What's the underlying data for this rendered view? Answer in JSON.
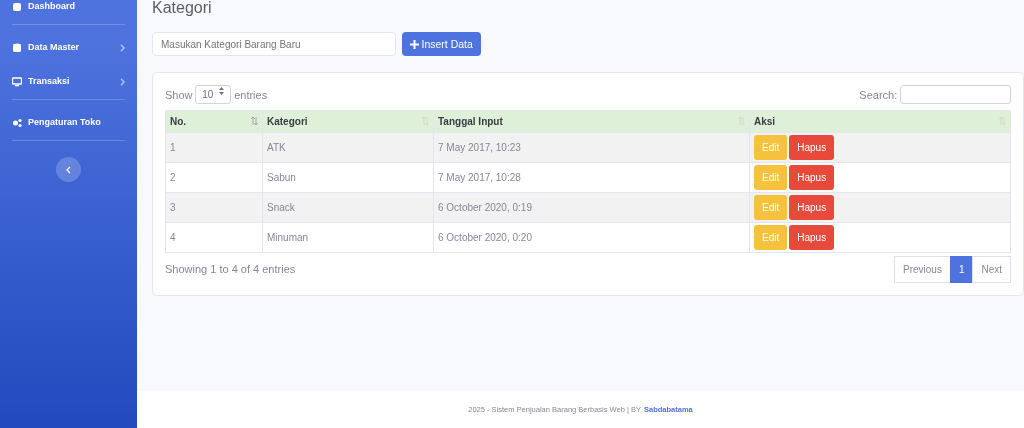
{
  "sidebar": {
    "items": [
      {
        "label": "Dashboard",
        "has_arrow": false,
        "divider_after": true
      },
      {
        "label": "Data Master",
        "has_arrow": true,
        "divider_after": false
      },
      {
        "label": "Transaksi",
        "has_arrow": true,
        "divider_after": true
      },
      {
        "label": "Pengaturan Toko",
        "has_arrow": false,
        "divider_after": true
      }
    ]
  },
  "page_title": "Kategori",
  "new_category": {
    "placeholder": "Masukan Kategori Barang Baru",
    "button": "Insert Data"
  },
  "table_controls": {
    "show": "Show",
    "page_size": "10",
    "entries": "entries",
    "search_label": "Search:"
  },
  "table": {
    "columns": [
      "No.",
      "Kategori",
      "Tanggal Input",
      "Aksi"
    ],
    "rows": [
      {
        "no": "1",
        "kategori": "ATK",
        "tanggal": "7 May 2017, 10:23",
        "actions": [
          "Edit",
          "Hapus"
        ]
      },
      {
        "no": "2",
        "kategori": "Sabun",
        "tanggal": "7 May 2017, 10:28",
        "actions": [
          "Edit",
          "Hapus"
        ]
      },
      {
        "no": "3",
        "kategori": "Snack",
        "tanggal": "6 October 2020, 0:19",
        "actions": [
          "Edit",
          "Hapus"
        ]
      },
      {
        "no": "4",
        "kategori": "Minuman",
        "tanggal": "6 October 2020, 0:20",
        "actions": [
          "Edit",
          "Hapus"
        ]
      }
    ]
  },
  "table_info": "Showing 1 to 4 of 4 entries",
  "pagination": [
    {
      "label": "Previous",
      "selected": false
    },
    {
      "label": "1",
      "selected": true
    },
    {
      "label": "Next",
      "selected": false
    }
  ],
  "footer": {
    "text": "2025 - Sistem Penjualan Barang Berbasis Web | BY",
    "link": "Sabdabatama"
  }
}
